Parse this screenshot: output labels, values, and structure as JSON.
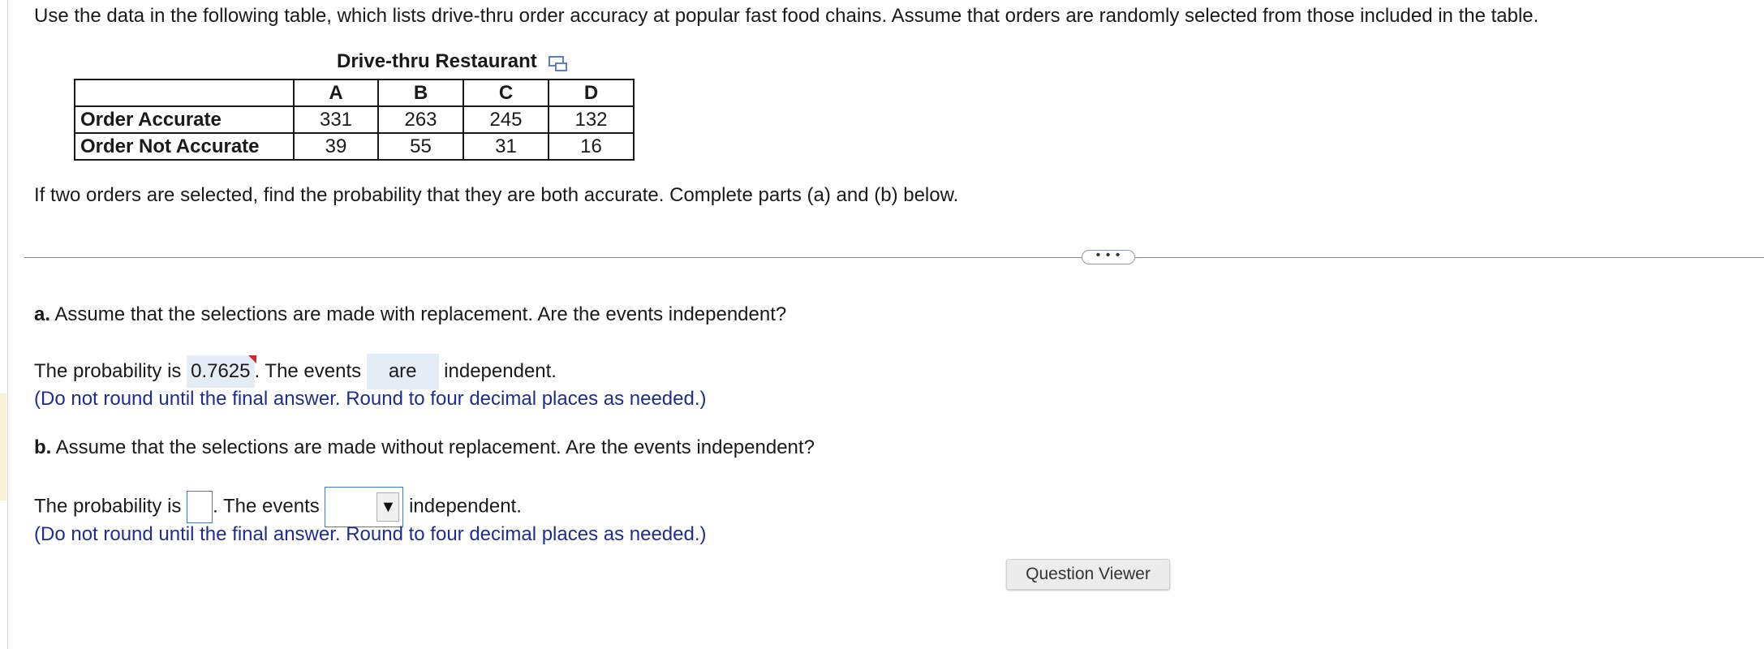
{
  "intro": "Use the data in the following table, which lists drive-thru order accuracy at popular fast food chains. Assume that orders are randomly selected from those included in the table.",
  "table": {
    "caption": "Drive-thru Restaurant",
    "popout_icon": "popout-icon",
    "columns": [
      "",
      "A",
      "B",
      "C",
      "D"
    ],
    "rows": [
      {
        "label": "Order Accurate",
        "values": [
          "331",
          "263",
          "245",
          "132"
        ]
      },
      {
        "label": "Order Not Accurate",
        "values": [
          "39",
          "55",
          "31",
          "16"
        ]
      }
    ]
  },
  "question": "If two orders are selected, find the probability that they are both accurate. Complete parts (a) and (b) below.",
  "more_button": "• • •",
  "part_a": {
    "label": "a.",
    "prompt": "Assume that the selections are made with replacement. Are the events independent?",
    "prob_prefix": "The probability is",
    "prob_value": "0.7625",
    "events_prefix": ". The events",
    "events_choice": "are",
    "events_suffix": "independent.",
    "note": "(Do not round until the final answer. Round to four decimal places as needed.)"
  },
  "part_b": {
    "label": "b.",
    "prompt": "Assume that the selections are made without replacement. Are the events independent?",
    "prob_prefix": "The probability is",
    "prob_value": "",
    "events_prefix": ". The events",
    "events_choice": "",
    "dropdown_arrow": "▼",
    "events_suffix": "independent.",
    "note": "(Do not round until the final answer. Round to four decimal places as needed.)"
  },
  "question_viewer_button": "Question Viewer",
  "colors": {
    "note_text": "#1f2d8f",
    "answer_bg": "#e4ecf6",
    "input_border": "#4a78c8",
    "flag": "#d7262c"
  }
}
